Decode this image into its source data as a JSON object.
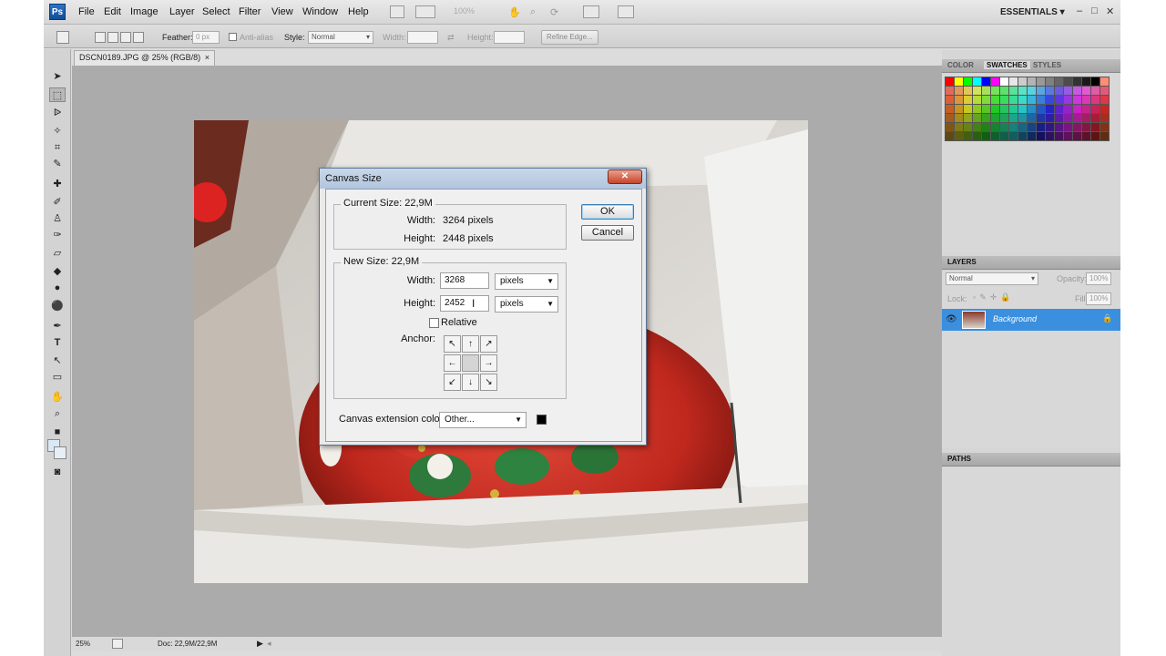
{
  "menu": {
    "logo": "Ps",
    "items": [
      "File",
      "Edit",
      "Image",
      "Layer",
      "Select",
      "Filter",
      "View",
      "Window",
      "Help"
    ],
    "zoom": "100%",
    "workspace": "ESSENTIALS",
    "window_buttons": [
      "–",
      "□",
      "✕"
    ]
  },
  "options": {
    "feather_label": "Feather:",
    "feather_value": "0 px",
    "antialias_label": "Anti-alias",
    "style_label": "Style:",
    "style_value": "Normal",
    "width_label": "Width:",
    "height_label": "Height:",
    "refine_label": "Refine Edge..."
  },
  "document": {
    "tab_title": "DSCN0189.JPG @ 25% (RGB/8)",
    "tab_close": "×",
    "status_zoom": "25%",
    "status_doc": "Doc: 22,9M/22,9M"
  },
  "panels": {
    "color_tabs": [
      "COLOR",
      "SWATCHES",
      "STYLES"
    ],
    "layers_title": "LAYERS",
    "blend_mode": "Normal",
    "opacity_label": "Opacity:",
    "opacity_value": "100%",
    "lock_label": "Lock:",
    "fill_label": "Fill:",
    "fill_value": "100%",
    "layer_name": "Background",
    "paths_title": "PATHS"
  },
  "dialog": {
    "title": "Canvas Size",
    "close": "✕",
    "current_size_title": "Current Size: 22,9M",
    "current_width_label": "Width:",
    "current_width_value": "3264 pixels",
    "current_height_label": "Height:",
    "current_height_value": "2448 pixels",
    "new_size_title": "New Size: 22,9M",
    "new_width_label": "Width:",
    "new_width_value": "3268",
    "new_width_unit": "pixels",
    "new_height_label": "Height:",
    "new_height_value": "2452",
    "new_height_unit": "pixels",
    "relative_label": "Relative",
    "relative_checked": false,
    "anchor_label": "Anchor:",
    "anchor_arrows": [
      "↖",
      "↑",
      "↗",
      "←",
      "",
      "→",
      "↙",
      "↓",
      "↘"
    ],
    "ext_color_label": "Canvas extension color:",
    "ext_color_value": "Other...",
    "ext_color_swatch": "#000000",
    "ok_label": "OK",
    "cancel_label": "Cancel"
  },
  "colors": {
    "selected_layer": "#3b8fdf",
    "swatch_colors": [
      "#ff0000",
      "#ffff00",
      "#00ff00",
      "#00ffff",
      "#0000ff",
      "#ff00ff",
      "#ffffff",
      "#e6e6e6",
      "#cccccc",
      "#b3b3b3",
      "#999999",
      "#808080",
      "#666666",
      "#4d4d4d",
      "#333333",
      "#1a1a1a",
      "#000000",
      "#ff8c73",
      "#ffc864",
      "#fff57d"
    ]
  }
}
